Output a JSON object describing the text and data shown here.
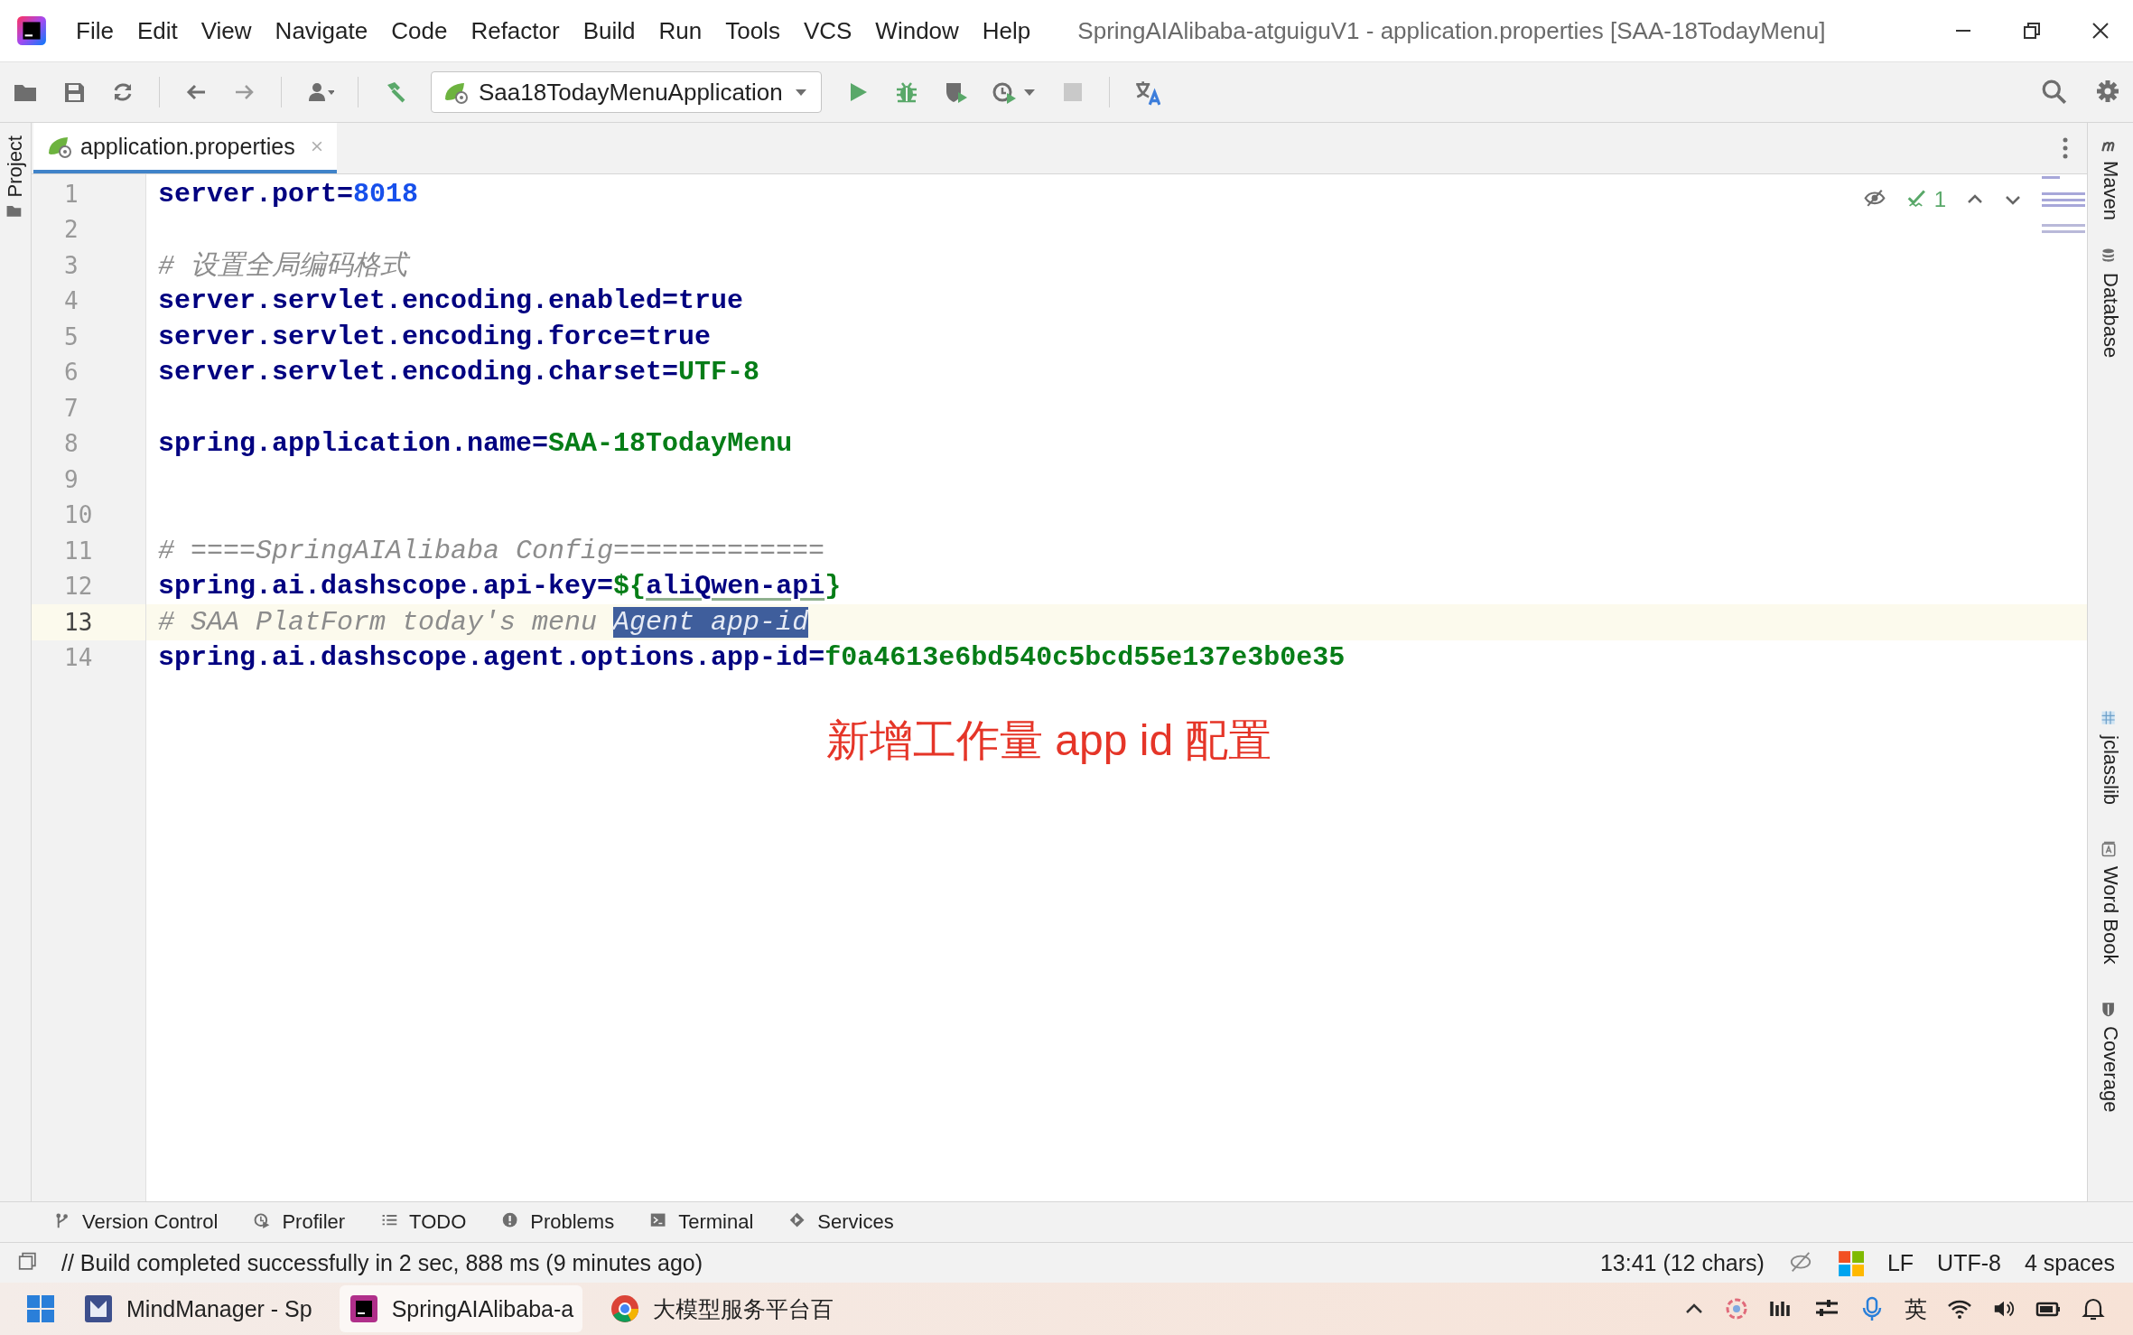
{
  "window": {
    "title": "SpringAIAlibaba-atguiguV1 - application.properties [SAA-18TodayMenu]"
  },
  "menu": [
    "File",
    "Edit",
    "View",
    "Navigate",
    "Code",
    "Refactor",
    "Build",
    "Run",
    "Tools",
    "VCS",
    "Window",
    "Help"
  ],
  "toolbar": {
    "run_configuration": "Saa18TodayMenuApplication"
  },
  "left_strip": [
    {
      "label": "Project",
      "kind": "project"
    }
  ],
  "tabs": [
    {
      "label": "application.properties",
      "selected": true
    }
  ],
  "editor": {
    "inspection_count": "1",
    "annotation": "新增工作量 app id 配置",
    "lines": [
      {
        "number": "1",
        "current": false,
        "tokens": [
          {
            "kind": "key",
            "text": "server.port"
          },
          {
            "kind": "op",
            "text": "="
          },
          {
            "kind": "number",
            "text": "8018"
          }
        ]
      },
      {
        "number": "2",
        "current": false
      },
      {
        "number": "3",
        "current": false,
        "tokens": [
          {
            "kind": "comment",
            "text": "# 设置全局编码格式"
          }
        ]
      },
      {
        "number": "4",
        "current": false,
        "tokens": [
          {
            "kind": "key",
            "text": "server.servlet.encoding.enabled"
          },
          {
            "kind": "op",
            "text": "="
          },
          {
            "kind": "key",
            "text": "true"
          }
        ]
      },
      {
        "number": "5",
        "current": false,
        "tokens": [
          {
            "kind": "key",
            "text": "server.servlet.encoding.force"
          },
          {
            "kind": "op",
            "text": "="
          },
          {
            "kind": "key",
            "text": "true"
          }
        ]
      },
      {
        "number": "6",
        "current": false,
        "tokens": [
          {
            "kind": "key",
            "text": "server.servlet.encoding.charset"
          },
          {
            "kind": "op",
            "text": "="
          },
          {
            "kind": "value",
            "text": "UTF-8"
          }
        ]
      },
      {
        "number": "7",
        "current": false
      },
      {
        "number": "8",
        "current": false,
        "tokens": [
          {
            "kind": "key",
            "text": "spring.application.name"
          },
          {
            "kind": "op",
            "text": "="
          },
          {
            "kind": "value",
            "text": "SAA-18TodayMenu"
          }
        ]
      },
      {
        "number": "9",
        "current": false
      },
      {
        "number": "10",
        "current": false
      },
      {
        "number": "11",
        "current": false,
        "tokens": [
          {
            "kind": "comment",
            "text": "# ====SpringAIAlibaba Config============="
          }
        ]
      },
      {
        "number": "12",
        "current": false,
        "tokens": [
          {
            "kind": "key",
            "text": "spring.ai.dashscope.api-key"
          },
          {
            "kind": "op",
            "text": "="
          },
          {
            "kind": "value",
            "text": "${"
          },
          {
            "kind": "reference",
            "text": "aliQwen-api"
          },
          {
            "kind": "value",
            "text": "}"
          }
        ]
      },
      {
        "number": "13",
        "current": true,
        "tokens": [
          {
            "kind": "comment",
            "text": "# SAA PlatForm today's menu "
          },
          {
            "kind": "selection",
            "text": "Agent app-id"
          }
        ]
      },
      {
        "number": "14",
        "current": false,
        "tokens": [
          {
            "kind": "key",
            "text": "spring.ai.dashscope.agent.options.app-id"
          },
          {
            "kind": "op",
            "text": "="
          },
          {
            "kind": "value",
            "text": "f0a4613e6bd540c5bcd55e137e3b0e35"
          }
        ]
      }
    ]
  },
  "right_strip": [
    {
      "label": "Maven",
      "kind": "maven"
    },
    {
      "label": "Database",
      "kind": "database"
    },
    {
      "label": "jclasslib",
      "kind": "jclasslib"
    },
    {
      "label": "Word Book",
      "kind": "wordbook"
    },
    {
      "label": "Coverage",
      "kind": "coverage"
    }
  ],
  "tool_windows": [
    {
      "label": "Version Control",
      "kind": "vcs"
    },
    {
      "label": "Profiler",
      "kind": "profiler"
    },
    {
      "label": "TODO",
      "kind": "todo"
    },
    {
      "label": "Problems",
      "kind": "problems"
    },
    {
      "label": "Terminal",
      "kind": "terminal"
    },
    {
      "label": "Services",
      "kind": "services"
    }
  ],
  "status_bar": {
    "message": "// Build completed successfully in 2 sec, 888 ms (9 minutes ago)",
    "position": "13:41 (12 chars)",
    "line_separator": "LF",
    "encoding": "UTF-8",
    "indent": "4 spaces"
  },
  "taskbar": {
    "items": [
      {
        "label": "MindManager - Sp",
        "kind": "mindmanager",
        "selected": false
      },
      {
        "label": "SpringAIAlibaba-a",
        "kind": "intellij",
        "selected": true
      },
      {
        "label": "大模型服务平台百",
        "kind": "chrome",
        "selected": false
      }
    ],
    "ime": "英"
  }
}
